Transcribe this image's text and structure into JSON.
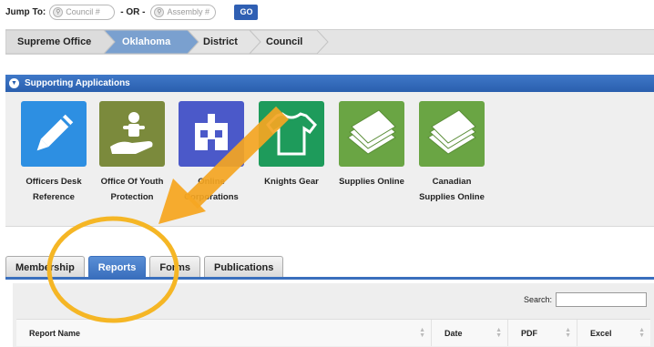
{
  "jump": {
    "label": "Jump To:",
    "council_placeholder": "Council #",
    "or_label": "- OR -",
    "assembly_placeholder": "Assembly #",
    "go_label": "GO"
  },
  "breadcrumb": [
    "Supreme Office",
    "Oklahoma",
    "District",
    "Council"
  ],
  "supporting": {
    "title": "Supporting Applications",
    "apps": [
      {
        "label": "Officers Desk Reference",
        "icon": "pencil-icon",
        "color": "#2d8fe2"
      },
      {
        "label": "Office Of Youth Protection",
        "icon": "child-hand-icon",
        "color": "#7b8a3c"
      },
      {
        "label": "Online Corporations",
        "icon": "building-icon",
        "color": "#4b59c9"
      },
      {
        "label": "Knights Gear",
        "icon": "shirt-icon",
        "color": "#1e9b5b"
      },
      {
        "label": "Supplies Online",
        "icon": "papers-icon",
        "color": "#6aa544"
      },
      {
        "label": "Canadian Supplies Online",
        "icon": "papers-icon",
        "color": "#6aa544"
      }
    ]
  },
  "tabs": [
    {
      "label": "Membership",
      "active": false
    },
    {
      "label": "Reports",
      "active": true
    },
    {
      "label": "Forms",
      "active": false
    },
    {
      "label": "Publications",
      "active": false
    }
  ],
  "table": {
    "search_label": "Search:",
    "columns": [
      "Report Name",
      "Date",
      "PDF",
      "Excel"
    ]
  },
  "annotation": {
    "arrow_color": "#f5a623",
    "circle_color": "#f5b625"
  }
}
